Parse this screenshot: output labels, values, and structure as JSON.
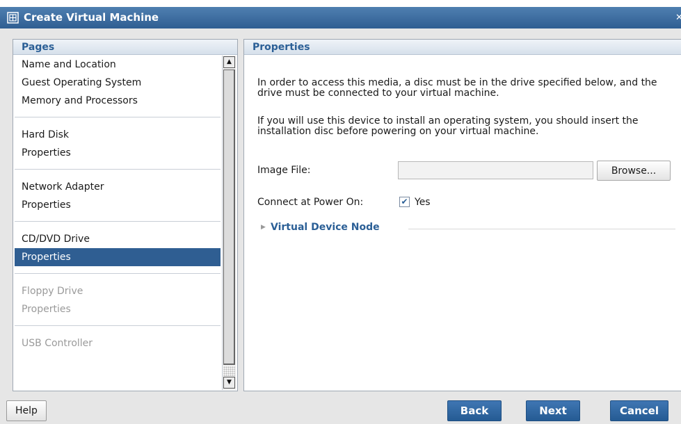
{
  "window": {
    "title": "Create Virtual Machine",
    "close_glyph": "✕"
  },
  "pages_panel": {
    "header": "Pages",
    "groups": [
      {
        "items": [
          {
            "label": "Name and Location"
          },
          {
            "label": "Guest Operating System"
          },
          {
            "label": "Memory and Processors"
          }
        ]
      },
      {
        "items": [
          {
            "label": "Hard Disk"
          },
          {
            "label": "Properties"
          }
        ]
      },
      {
        "items": [
          {
            "label": "Network Adapter"
          },
          {
            "label": "Properties"
          }
        ]
      },
      {
        "items": [
          {
            "label": "CD/DVD Drive"
          },
          {
            "label": "Properties",
            "selected": true
          }
        ]
      },
      {
        "items": [
          {
            "label": "Floppy Drive",
            "disabled": true
          },
          {
            "label": "Properties",
            "disabled": true
          }
        ]
      },
      {
        "items": [
          {
            "label": "USB Controller",
            "disabled": true
          }
        ]
      }
    ],
    "scroll_up_glyph": "▲",
    "scroll_down_glyph": "▼"
  },
  "properties_panel": {
    "header": "Properties",
    "paragraph1": "In order to access this media, a disc must be in the drive specified below, and the drive must be connected to your virtual machine.",
    "paragraph2": "If you will use this device to install an operating system, you should insert the installation disc before powering on your virtual machine.",
    "image_file_label": "Image File:",
    "image_file_value": "",
    "browse_label": "Browse...",
    "connect_label": "Connect at Power On:",
    "connect_checked": true,
    "connect_option": "Yes",
    "check_glyph": "✔",
    "section_caret_glyph": "▶",
    "section_title": "Virtual Device Node"
  },
  "footer": {
    "help_label": "Help",
    "back_label": "Back",
    "next_label": "Next",
    "cancel_label": "Cancel"
  },
  "colors": {
    "accent": "#2f5e92",
    "header_text": "#2b5f96",
    "disabled_text": "#9a9a9a"
  }
}
